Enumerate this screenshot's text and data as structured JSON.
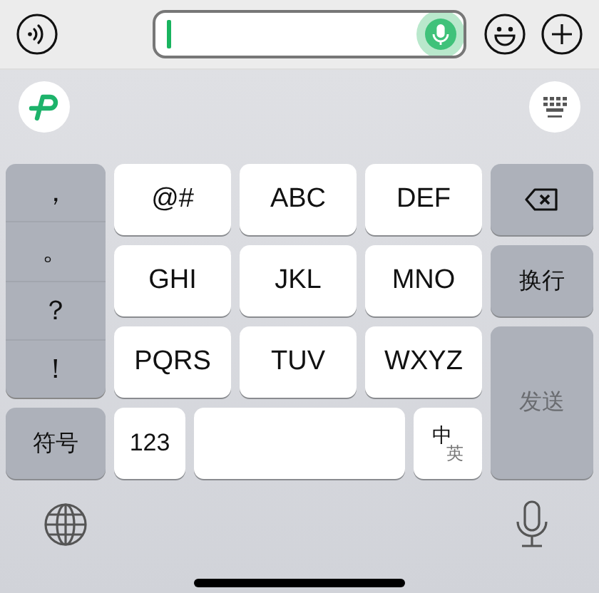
{
  "symbol_keys": [
    "，",
    "。",
    "？",
    "！"
  ],
  "letter_keys": [
    "@#",
    "ABC",
    "DEF",
    "GHI",
    "JKL",
    "MNO",
    "PQRS",
    "TUV",
    "WXYZ"
  ],
  "return_key": "换行",
  "send_key": {
    "label": "发送",
    "disabled": true
  },
  "symbols_key": "符号",
  "number_key": "123",
  "language_key": {
    "primary": "中",
    "secondary": "英"
  }
}
